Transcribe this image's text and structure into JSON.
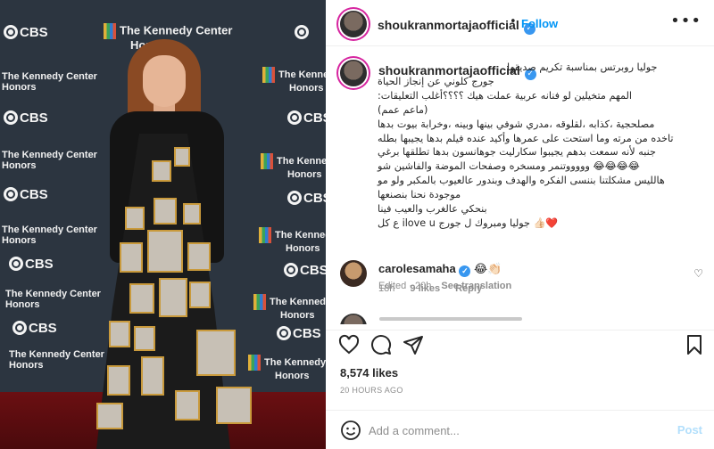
{
  "photo": {
    "alt": "",
    "sponsor_kennedy": "The Kennedy Center Honors",
    "sponsor_kennedy_line1": "The Kennedy Center",
    "sponsor_kennedy_line2": "Honors",
    "sponsor_cbs": "CBS"
  },
  "post": {
    "username": "shoukranmortajaofficial",
    "follow_label": "Follow",
    "dot": "•",
    "more_label": "•••"
  },
  "caption": {
    "username": "shoukranmortajaofficial",
    "lines": [
      "جوليا روبرتس بمناسبة تكريم صديقها",
      "جورج كلوني عن إنجاز الحياة",
      "المهم متخيلين لو فنانه عربية عملت هيك ؟؟؟؟أغلب التعليقات:",
      "(ماعم عمم)",
      "مصلحجية ،كذابه ،لقلوقه ،مدري شوفي بينها وبينه ،وخرابة بيوت بدها",
      "تاخده من مرته وما استحت على عمرها وأكيد عنده فيلم بدها يجيبها بطله",
      "جنبه لأنه سمعت بدهم يجيبوا سكارليت جوهانسون بدها تطلقها برغي",
      "😂😂😂😂 وووووتنمر ومسخره وصفحات الموضة والفاشين شو",
      "هالليس مشكلتنا بننسى الفكره والهدف وبندور عالعيوب بالمكبر ولو مو",
      "موجودة نحنا بنصنعها",
      "بنحكي عالغرب والعيب فينا",
      "❤️👍🏻 جوليا ومبروك ل جورج ilove u ع كل"
    ],
    "edited": "Edited · 20h",
    "see_translation": "See translation"
  },
  "comments": [
    {
      "username": "carolesamaha",
      "emoji": "😂👏🏻",
      "time": "18h",
      "likes": "9 likes",
      "reply": "Reply"
    }
  ],
  "actions": {
    "likes": "8,574 likes",
    "timestamp": "20 HOURS AGO"
  },
  "composer": {
    "placeholder": "Add a comment...",
    "post_label": "Post"
  },
  "colors": {
    "accent": "#0095f6",
    "verified": "#3897f0",
    "post_disabled": "#b2dffc",
    "muted": "#8e8e8e"
  },
  "icons": [
    "heart-icon",
    "comment-icon",
    "share-icon",
    "bookmark-icon",
    "emoji-icon",
    "verified-icon",
    "more-icon"
  ]
}
